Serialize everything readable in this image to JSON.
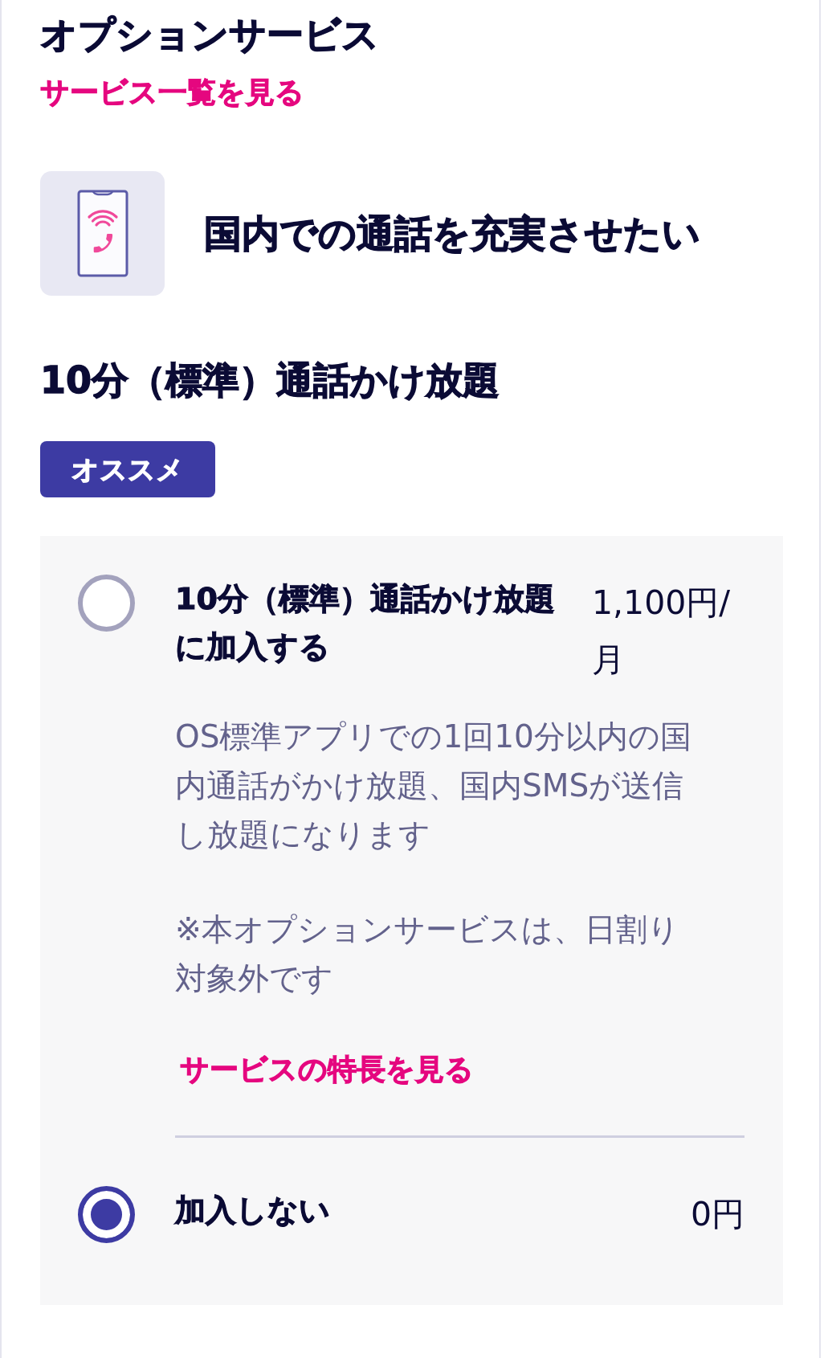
{
  "page": {
    "title": "オプションサービス",
    "list_link": "サービス一覧を見る"
  },
  "category": {
    "heading": "国内での通話を充実させたい"
  },
  "plan": {
    "title": "10分（標準）通話かけ放題",
    "badge": "オススメ",
    "options": [
      {
        "label": "10分（標準）通話かけ放題に加入する",
        "price": "1,100円/月",
        "selected": false,
        "description": "OS標準アプリでの1回10分以内の国内通話がかけ放題、国内SMSが送信し放題になります",
        "note": "※本オプションサービスは、日割り対象外です",
        "link": "サービスの特長を見る"
      },
      {
        "label": "加入しない",
        "price": "0円",
        "selected": true
      }
    ]
  }
}
